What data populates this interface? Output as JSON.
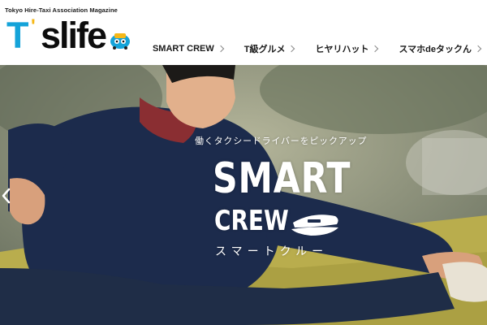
{
  "header": {
    "tagline": "Tokyo Hire-Taxi Association Magazine",
    "logo": {
      "letter": "T",
      "apostrophe": "'",
      "word": "slife",
      "mascot_icon": "taxi-mascot-icon"
    }
  },
  "nav": {
    "items": [
      {
        "label": "SMART CREW",
        "icon": "chevron-right-icon"
      },
      {
        "label": "T級グルメ",
        "icon": "chevron-right-icon"
      },
      {
        "label": "ヒヤリハット",
        "icon": "chevron-right-icon"
      },
      {
        "label": "スマホdeタックん",
        "icon": "chevron-right-icon"
      }
    ]
  },
  "hero": {
    "subtitle": "働くタクシードライバーをピックアップ",
    "title": "SMART",
    "title2": "CREW",
    "kana": "スマートクルー",
    "cap_icon": "driver-cap-icon",
    "prev_icon": "chevron-left-icon"
  },
  "colors": {
    "brand_blue": "#14a3d9",
    "brand_yellow": "#f6b818",
    "text_dark": "#1a1a1a",
    "hero_text": "#ffffff"
  }
}
